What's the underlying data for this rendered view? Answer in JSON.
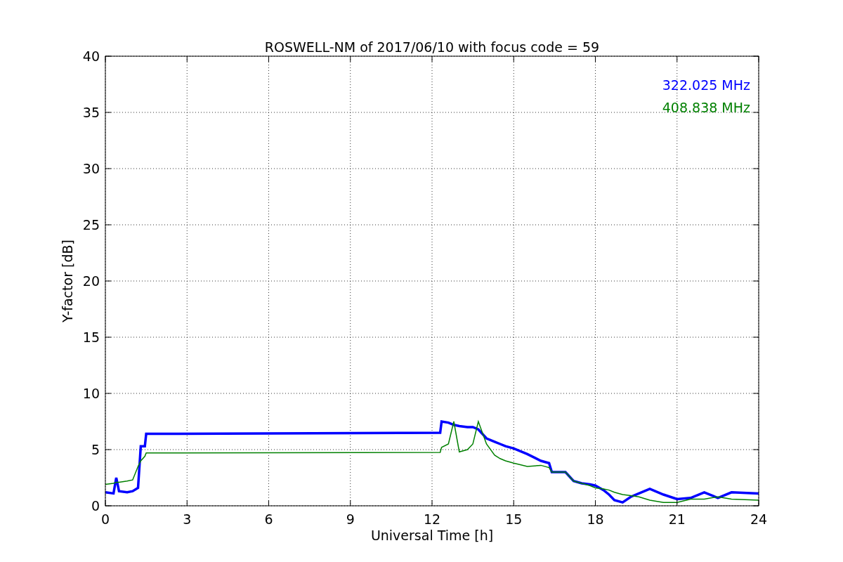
{
  "chart_data": {
    "type": "line",
    "title": "ROSWELL-NM of 2017/06/10 with focus code = 59",
    "xlabel": "Universal Time [h]",
    "ylabel": "Y-factor [dB]",
    "x": [
      0,
      0.3,
      0.4,
      0.5,
      0.8,
      1,
      1.2,
      1.3,
      1.45,
      1.5,
      12.3,
      12.35,
      12.6,
      12.8,
      13,
      13.3,
      13.5,
      13.7,
      14,
      14.3,
      14.5,
      14.7,
      15,
      15.5,
      16,
      16.3,
      16.4,
      16.9,
      17.2,
      17.5,
      17.8,
      18,
      18.3,
      18.5,
      18.7,
      19,
      19.3,
      19.6,
      20,
      20.5,
      21,
      21.5,
      22,
      22.5,
      23,
      24
    ],
    "series": [
      {
        "name": "322.025 MHz",
        "color": "#0000ff",
        "values": [
          1.2,
          1.1,
          2.5,
          1.3,
          1.2,
          1.3,
          1.6,
          5.3,
          5.3,
          6.4,
          6.5,
          7.5,
          7.4,
          7.2,
          7.1,
          7.0,
          7.0,
          6.8,
          6.0,
          5.7,
          5.5,
          5.3,
          5.1,
          4.6,
          4.0,
          3.8,
          3.0,
          3.0,
          2.2,
          2.0,
          1.9,
          1.8,
          1.4,
          1.0,
          0.5,
          0.3,
          0.8,
          1.1,
          1.5,
          1.0,
          0.6,
          0.7,
          1.2,
          0.7,
          1.2,
          1.1
        ]
      },
      {
        "name": "408.838 MHz",
        "color": "#008000",
        "values": [
          1.9,
          2.0,
          2.1,
          2.1,
          2.2,
          2.3,
          3.5,
          4.0,
          4.4,
          4.7,
          4.75,
          5.2,
          5.5,
          7.5,
          4.8,
          5.0,
          5.5,
          7.5,
          5.5,
          4.5,
          4.2,
          4.0,
          3.8,
          3.5,
          3.6,
          3.4,
          3.0,
          3.0,
          2.2,
          2.0,
          1.8,
          1.6,
          1.5,
          1.4,
          1.2,
          1.0,
          0.9,
          0.8,
          0.5,
          0.3,
          0.3,
          0.6,
          0.6,
          0.8,
          0.6,
          0.5
        ]
      }
    ],
    "xlim": [
      0,
      24
    ],
    "ylim": [
      0,
      40
    ],
    "xticks": [
      0,
      3,
      6,
      9,
      12,
      15,
      18,
      21,
      24
    ],
    "yticks": [
      0,
      5,
      10,
      15,
      20,
      25,
      30,
      35,
      40
    ],
    "grid": true
  }
}
